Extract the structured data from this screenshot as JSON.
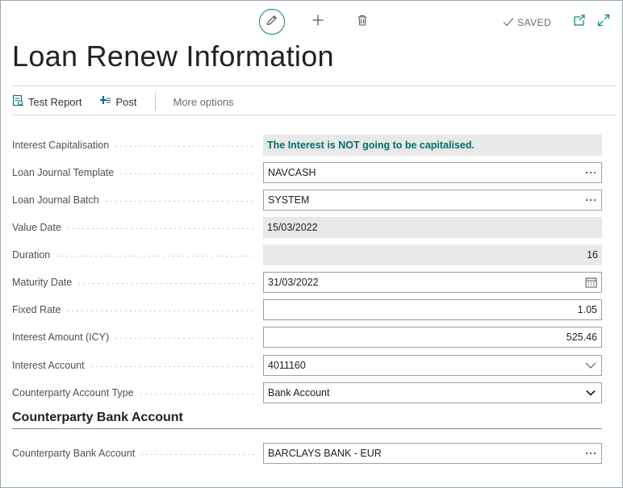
{
  "toolbar": {
    "edit_icon": "pencil-icon",
    "new_icon": "plus-icon",
    "delete_icon": "trash-icon",
    "saved_label": "SAVED",
    "open_new_window_icon": "open-in-new-window-icon",
    "expand_icon": "expand-icon"
  },
  "page": {
    "title": "Loan Renew Information"
  },
  "actions": {
    "test_report": "Test Report",
    "post": "Post",
    "more_options": "More options"
  },
  "fields": {
    "interest_capitalisation": {
      "label": "Interest Capitalisation",
      "value": "The Interest is NOT going to be capitalised."
    },
    "loan_journal_template": {
      "label": "Loan Journal Template",
      "value": "NAVCASH"
    },
    "loan_journal_batch": {
      "label": "Loan Journal Batch",
      "value": "SYSTEM"
    },
    "value_date": {
      "label": "Value Date",
      "value": "15/03/2022"
    },
    "duration": {
      "label": "Duration",
      "value": "16"
    },
    "maturity_date": {
      "label": "Maturity Date",
      "value": "31/03/2022"
    },
    "fixed_rate": {
      "label": "Fixed Rate",
      "value": "1.05"
    },
    "interest_amount": {
      "label": "Interest Amount (ICY)",
      "value": "525.46"
    },
    "interest_account": {
      "label": "Interest Account",
      "value": "4011160"
    },
    "counterparty_account_type": {
      "label": "Counterparty Account Type",
      "value": "Bank Account"
    }
  },
  "section": {
    "title": "Counterparty Bank Account",
    "counterparty_bank_account": {
      "label": "Counterparty Bank Account",
      "value": "BARCLAYS BANK - EUR"
    }
  },
  "colors": {
    "accent": "#00827f",
    "banner_text": "#00706d",
    "readonly_bg": "#e8e8e8"
  }
}
